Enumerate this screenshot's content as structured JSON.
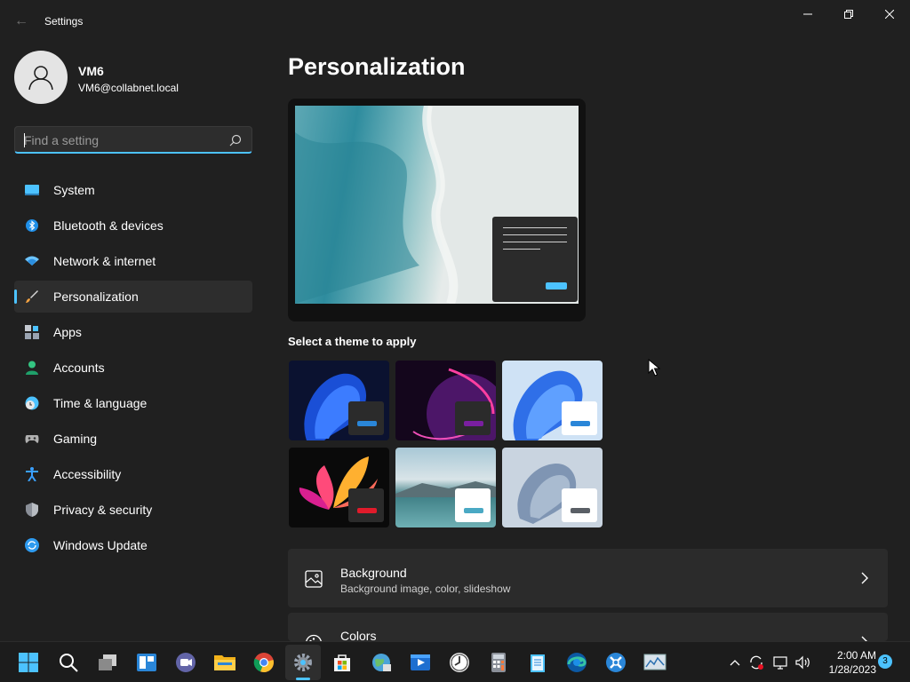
{
  "window": {
    "title": "Settings",
    "back_label": "←"
  },
  "user": {
    "name": "VM6",
    "email": "VM6@collabnet.local"
  },
  "search": {
    "placeholder": "Find a setting"
  },
  "sidebar": {
    "items": [
      {
        "label": "System",
        "icon": "system-icon",
        "color": "#4cc2ff"
      },
      {
        "label": "Bluetooth & devices",
        "icon": "bluetooth-icon",
        "color": "#1f8fe8"
      },
      {
        "label": "Network & internet",
        "icon": "wifi-icon",
        "color": "#6cc4ff"
      },
      {
        "label": "Personalization",
        "icon": "brush-icon",
        "color": "#f5a442",
        "active": true
      },
      {
        "label": "Apps",
        "icon": "apps-icon",
        "color": "#9aa4b2"
      },
      {
        "label": "Accounts",
        "icon": "accounts-icon",
        "color": "#33c481"
      },
      {
        "label": "Time & language",
        "icon": "clock-globe-icon",
        "color": "#4cc2ff"
      },
      {
        "label": "Gaming",
        "icon": "gamepad-icon",
        "color": "#b0b0b0"
      },
      {
        "label": "Accessibility",
        "icon": "accessibility-icon",
        "color": "#3aa0ff"
      },
      {
        "label": "Privacy & security",
        "icon": "shield-icon",
        "color": "#8a8f98"
      },
      {
        "label": "Windows Update",
        "icon": "update-icon",
        "color": "#2e9bf0"
      }
    ]
  },
  "main": {
    "title": "Personalization",
    "themes_label": "Select a theme to apply",
    "themes": [
      {
        "name": "windows-dark",
        "accent": "#2a86d8"
      },
      {
        "name": "glow",
        "accent": "#7a1fa0"
      },
      {
        "name": "windows-light",
        "accent": "#2a86d8"
      },
      {
        "name": "captured-motion",
        "accent": "#e01b2b"
      },
      {
        "name": "sunrise",
        "accent": "#4aa9c4"
      },
      {
        "name": "flow",
        "accent": "#5a5f66"
      }
    ],
    "cards": [
      {
        "title": "Background",
        "subtitle": "Background image, color, slideshow",
        "icon": "image-icon"
      },
      {
        "title": "Colors",
        "subtitle": "",
        "icon": "palette-icon"
      }
    ]
  },
  "taskbar": {
    "apps": [
      "start-icon",
      "search-icon",
      "task-view-icon",
      "widgets-icon",
      "teams-chat-icon",
      "file-explorer-icon",
      "chrome-icon",
      "settings-icon",
      "store-icon",
      "network-globe-icon",
      "media-player-icon",
      "clock-app-icon",
      "calculator-icon",
      "notepad-icon",
      "edge-icon",
      "vscode-like-icon",
      "monitor-icon"
    ],
    "time": "2:00 AM",
    "date": "1/28/2023",
    "notification_count": "3"
  },
  "colors": {
    "accent": "#4cc2ff",
    "background": "#202020",
    "card": "#2b2b2b"
  }
}
